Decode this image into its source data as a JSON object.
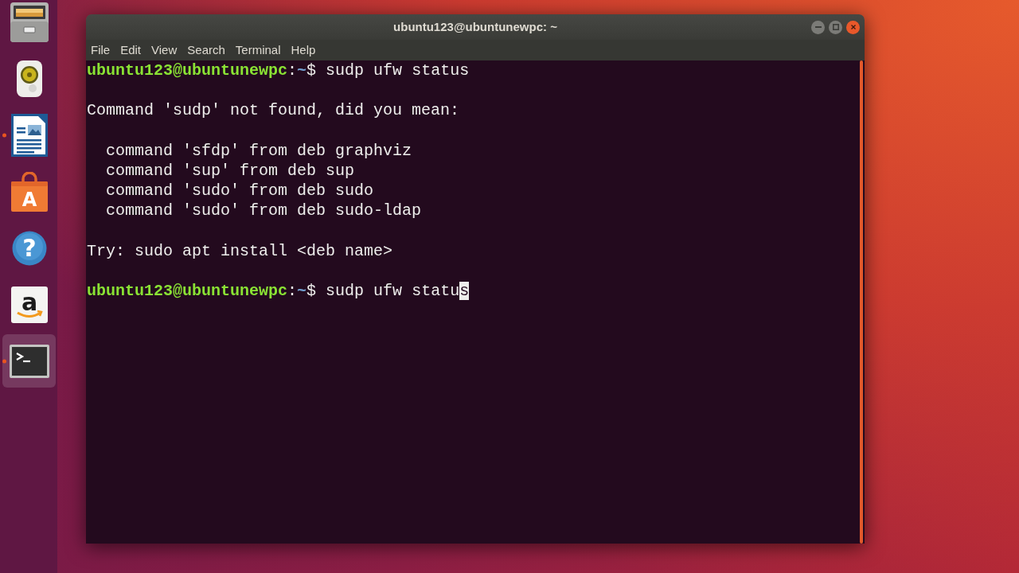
{
  "dock": {
    "items": [
      {
        "kind": "files",
        "running": false,
        "selected": false
      },
      {
        "kind": "music",
        "running": false,
        "selected": false
      },
      {
        "kind": "writer",
        "running": true,
        "selected": false
      },
      {
        "kind": "software",
        "glyph": "A",
        "running": false,
        "selected": false
      },
      {
        "kind": "help",
        "glyph": "?",
        "running": false,
        "selected": false
      },
      {
        "kind": "amazon",
        "glyph": "a",
        "running": false,
        "selected": false
      },
      {
        "kind": "terminal",
        "running": true,
        "selected": true
      }
    ]
  },
  "window": {
    "title": "ubuntu123@ubuntunewpc: ~",
    "menu": [
      "File",
      "Edit",
      "View",
      "Search",
      "Terminal",
      "Help"
    ],
    "terminal": {
      "lines": [
        {
          "kind": "prompt",
          "user_host": "ubuntu123@ubuntunewpc",
          "separator": ":",
          "path": "~",
          "symbol": "$",
          "command": "sudp ufw status",
          "cursor": false
        },
        {
          "kind": "blank"
        },
        {
          "kind": "output",
          "text": "Command 'sudp' not found, did you mean:"
        },
        {
          "kind": "blank"
        },
        {
          "kind": "suggestion",
          "text": "command 'sfdp' from deb graphviz"
        },
        {
          "kind": "suggestion",
          "text": "command 'sup' from deb sup"
        },
        {
          "kind": "suggestion",
          "text": "command 'sudo' from deb sudo"
        },
        {
          "kind": "suggestion",
          "text": "command 'sudo' from deb sudo-ldap"
        },
        {
          "kind": "blank"
        },
        {
          "kind": "output",
          "text": "Try: sudo apt install <deb name>"
        },
        {
          "kind": "blank"
        },
        {
          "kind": "prompt",
          "user_host": "ubuntu123@ubuntunewpc",
          "separator": ":",
          "path": "~",
          "symbol": "$",
          "command": "sudp ufw status",
          "cursor": true
        }
      ]
    }
  }
}
